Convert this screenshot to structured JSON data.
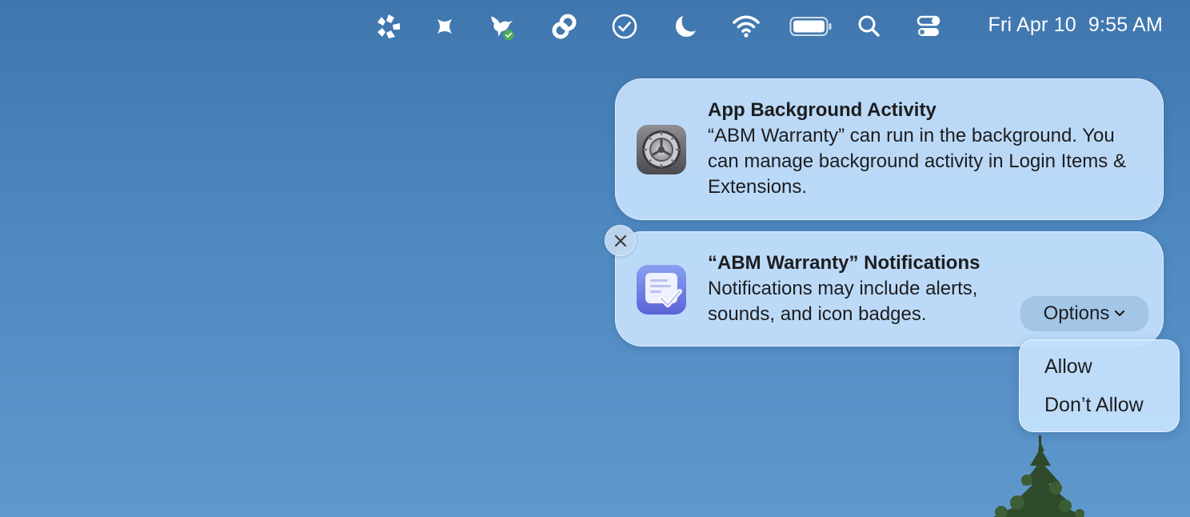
{
  "menubar": {
    "icons": [
      {
        "name": "aperture-app-icon"
      },
      {
        "name": "cross-sparkle-app-icon"
      },
      {
        "name": "hummingbird-check-app-icon"
      },
      {
        "name": "link-chain-app-icon"
      },
      {
        "name": "checkmark-circle-icon"
      },
      {
        "name": "focus-moon-icon"
      },
      {
        "name": "wifi-icon"
      },
      {
        "name": "battery-icon"
      },
      {
        "name": "spotlight-search-icon"
      },
      {
        "name": "control-center-icon"
      }
    ],
    "date": "Fri Apr 10",
    "time": "9:55 AM"
  },
  "notifications": [
    {
      "icon": "system-settings-gear-icon",
      "title": "App Background Activity",
      "body": "“ABM Warranty” can run in the background. You can manage background activity in Login Items & Extensions."
    },
    {
      "icon": "abm-warranty-app-icon",
      "title": "“ABM Warranty” Notifications",
      "body": "Notifications may include alerts, sounds, and icon badges.",
      "options_label": "Options",
      "options": [
        "Allow",
        "Don’t Allow"
      ]
    }
  ],
  "colors": {
    "wallpaper": "#4a85bd",
    "notification_bg": "#c4e0fc",
    "badge_green": "#4caf50"
  }
}
